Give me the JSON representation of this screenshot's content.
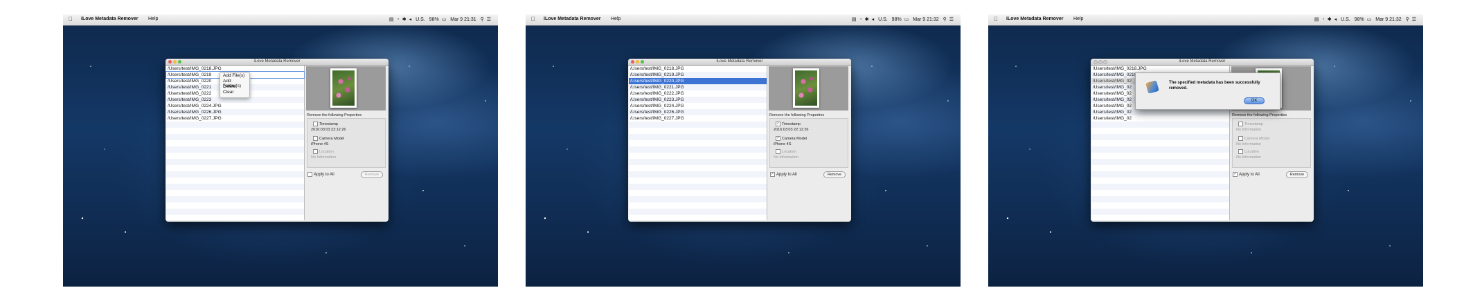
{
  "menubar": {
    "app_name": "iLove Metadata Remover",
    "help": "Help",
    "input_source": "U.S.",
    "battery": "98%",
    "clock_1": "Mar 9  21:31",
    "clock_2": "Mar 9  21:32",
    "clock_3": "Mar 9  21:32"
  },
  "window": {
    "title": "iLove Metadata Remover"
  },
  "files": [
    "/Users/test/IMG_0218.JPG",
    "/Users/test/IMG_0219.JPG",
    "/Users/test/IMG_0220.JPG",
    "/Users/test/IMG_0221.JPG",
    "/Users/test/IMG_0222.JPG",
    "/Users/test/IMG_0223.JPG",
    "/Users/test/IMG_0224.JPG",
    "/Users/test/IMG_0226.JPG",
    "/Users/test/IMG_0227.JPG"
  ],
  "files_truncated": [
    "/Users/test/IMG_0218.JPG",
    "/Users/test/IMG_0219",
    "/Users/test/IMG_0220",
    "/Users/test/IMG_0221",
    "/Users/test/IMG_0222",
    "/Users/test/IMG_0223"
  ],
  "files_dialog": [
    "/Users/test/IMG_0218.JPG",
    "/Users/test/IMG_0219.JPG",
    "/Users/test/IMG_02",
    "/Users/test/IMG_02",
    "/Users/test/IMG_02",
    "/Users/test/IMG_02",
    "/Users/test/IMG_02",
    "/Users/test/IMG_02",
    "/Users/test/IMG_02"
  ],
  "context_menu": [
    "Add File(s)",
    "Add Folder(s)",
    "Delete",
    "Clear"
  ],
  "properties": {
    "header": "Remove the following Properties",
    "timestamp_label": "Timestamp",
    "timestamp_value": "2016:03:03 22:12:26",
    "camera_label": "Camera Model",
    "camera_value": "iPhone 4S",
    "location_label": "Location",
    "location_value": "No Information",
    "no_info": "No Information"
  },
  "apply_all": "Apply to All",
  "remove_button": "Remove",
  "dialog": {
    "message": "The specified metadata has been successfully removed.",
    "ok": "OK"
  },
  "colors": {
    "selection": "#3d73d3",
    "desktop": "#143866"
  },
  "icons": [
    "apple-icon",
    "wifi-icon",
    "bluetooth-icon",
    "volume-icon",
    "flag-icon",
    "battery-icon",
    "spotlight-icon",
    "list-icon"
  ]
}
